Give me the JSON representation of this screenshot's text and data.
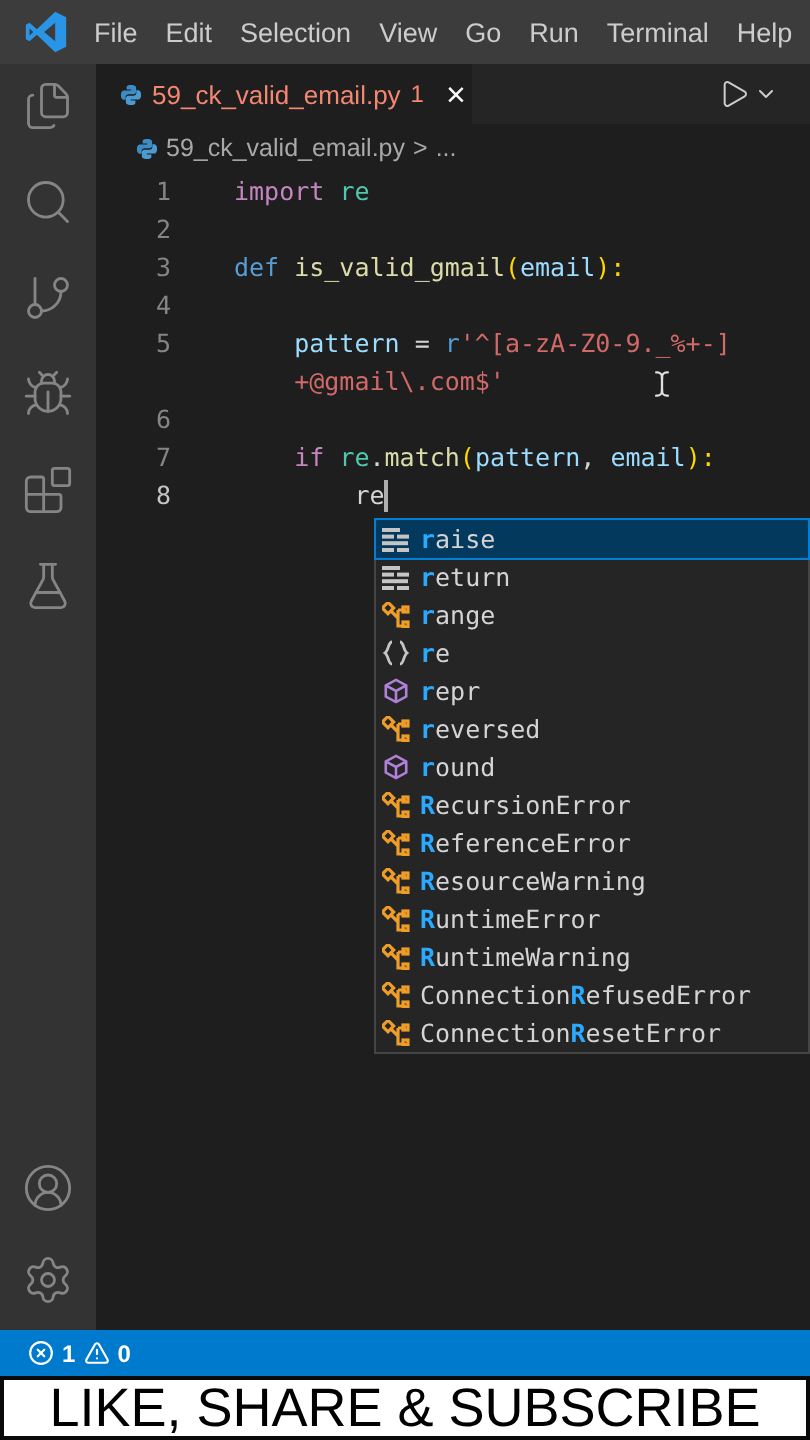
{
  "menu": [
    "File",
    "Edit",
    "Selection",
    "View",
    "Go",
    "Run",
    "Terminal",
    "Help"
  ],
  "tab": {
    "filename": "59_ck_valid_email.py",
    "problems": "1",
    "selected": true,
    "close": "×"
  },
  "breadcrumb": {
    "file": "59_ck_valid_email.py",
    "separator": ">",
    "more": "..."
  },
  "code_lines": [
    {
      "number": "1",
      "rows": [
        [
          {
            "text": "import",
            "kind": "keyword"
          },
          {
            "text": " ",
            "kind": "punct"
          },
          {
            "text": "re",
            "kind": "module"
          }
        ]
      ]
    },
    {
      "number": "2",
      "rows": [
        []
      ]
    },
    {
      "number": "3",
      "rows": [
        [
          {
            "text": "def",
            "kind": "storage"
          },
          {
            "text": " ",
            "kind": "punct"
          },
          {
            "text": "is_valid_gmail",
            "kind": "function"
          },
          {
            "text": "(",
            "kind": "bracket"
          },
          {
            "text": "email",
            "kind": "variable"
          },
          {
            "text": "):",
            "kind": "bracket"
          }
        ]
      ]
    },
    {
      "number": "4",
      "rows": [
        []
      ]
    },
    {
      "number": "5",
      "rows": [
        [
          {
            "text": "    pattern",
            "kind": "variable"
          },
          {
            "text": " = ",
            "kind": "punct"
          },
          {
            "text": "r",
            "kind": "storage"
          },
          {
            "text": "'^[a-zA-Z0-9._%+-]",
            "kind": "regex"
          }
        ],
        [
          {
            "text": "    +@gmail\\.com$'",
            "kind": "regex"
          }
        ]
      ]
    },
    {
      "number": "6",
      "rows": [
        []
      ]
    },
    {
      "number": "7",
      "rows": [
        [
          {
            "text": "    if",
            "kind": "keyword"
          },
          {
            "text": " ",
            "kind": "punct"
          },
          {
            "text": "re",
            "kind": "module"
          },
          {
            "text": ".",
            "kind": "punct"
          },
          {
            "text": "match",
            "kind": "function"
          },
          {
            "text": "(",
            "kind": "bracket"
          },
          {
            "text": "pattern",
            "kind": "variable"
          },
          {
            "text": ", ",
            "kind": "punct"
          },
          {
            "text": "email",
            "kind": "variable"
          },
          {
            "text": "):",
            "kind": "bracket"
          }
        ]
      ]
    },
    {
      "number": "8",
      "rows": [
        [
          {
            "text": "        re",
            "kind": "punct"
          }
        ]
      ]
    }
  ],
  "suggestions": [
    {
      "kind": "keyword",
      "match": "r",
      "suffix": "aise",
      "selected": true
    },
    {
      "kind": "keyword",
      "match": "r",
      "suffix": "eturn",
      "selected": false
    },
    {
      "kind": "class",
      "match": "r",
      "suffix": "ange",
      "selected": false
    },
    {
      "kind": "module",
      "match": "r",
      "suffix": "e",
      "selected": false
    },
    {
      "kind": "function",
      "match": "r",
      "suffix": "epr",
      "selected": false
    },
    {
      "kind": "class",
      "match": "r",
      "suffix": "eversed",
      "selected": false
    },
    {
      "kind": "function",
      "match": "r",
      "suffix": "ound",
      "selected": false
    },
    {
      "kind": "class",
      "match": "R",
      "suffix": "ecursionError",
      "selected": false
    },
    {
      "kind": "class",
      "match": "R",
      "suffix": "eferenceError",
      "selected": false
    },
    {
      "kind": "class",
      "match": "R",
      "suffix": "esourceWarning",
      "selected": false
    },
    {
      "kind": "class",
      "match": "R",
      "suffix": "untimeError",
      "selected": false
    },
    {
      "kind": "class",
      "match": "R",
      "suffix": "untimeWarning",
      "selected": false
    },
    {
      "kind": "class",
      "prefix": "Connection",
      "match": "R",
      "suffix": "efusedError",
      "selected": false
    },
    {
      "kind": "class",
      "prefix": "Connection",
      "match": "R",
      "suffix": "esetError",
      "selected": false
    }
  ],
  "status_bar": {
    "errors": "1",
    "warnings": "0"
  },
  "banner": "LIKE, SHARE & SUBSCRIBE"
}
